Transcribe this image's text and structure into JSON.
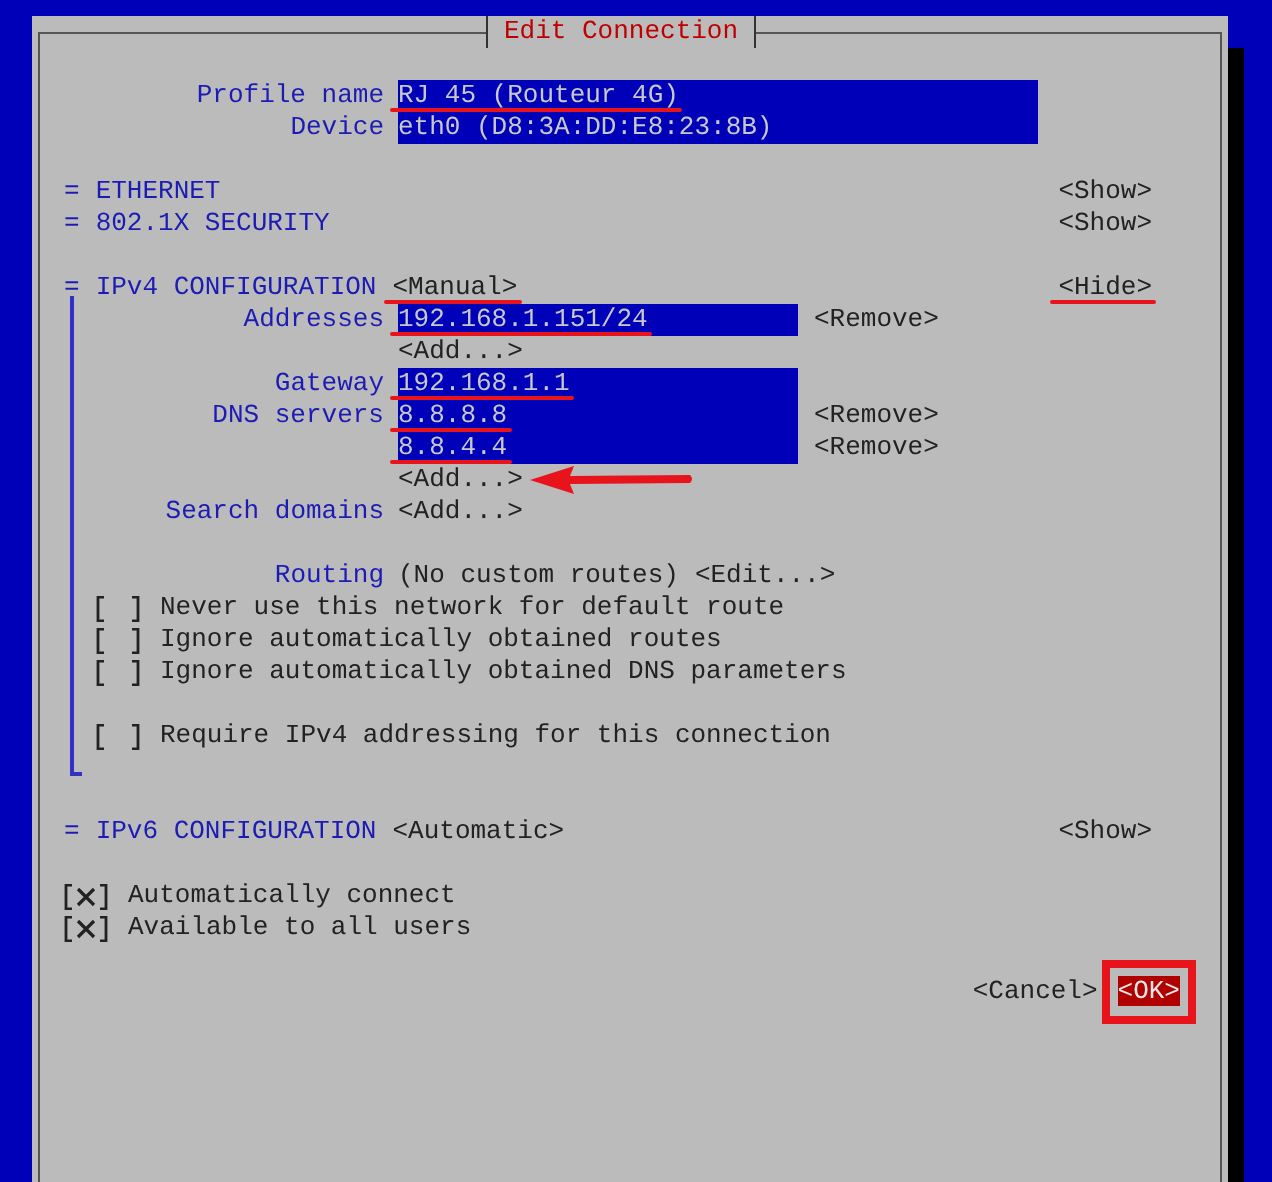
{
  "window": {
    "title": "Edit Connection"
  },
  "profile": {
    "label": "Profile name",
    "value": "RJ 45 (Routeur 4G)",
    "underlined": true
  },
  "device": {
    "label": "Device",
    "value": "eth0 (D8:3A:DD:E8:23:8B)"
  },
  "sections": [
    {
      "marker": "=",
      "title": "ETHERNET",
      "toggle": "<Show>"
    },
    {
      "marker": "=",
      "title": "802.1X SECURITY",
      "toggle": "<Show>"
    }
  ],
  "ipv4": {
    "marker": "=",
    "title": "IPv4 CONFIGURATION",
    "mode": "<Manual>",
    "mode_underlined": true,
    "toggle": "<Hide>",
    "toggle_underlined": true,
    "rows": [
      {
        "kind": "field",
        "label": "Addresses",
        "value": "192.168.1.151/24",
        "underlined": true,
        "action": "<Remove>"
      },
      {
        "kind": "button",
        "text": "<Add...>",
        "pointed": false
      },
      {
        "kind": "field",
        "label": "Gateway",
        "value": "192.168.1.1",
        "underlined": true
      },
      {
        "kind": "field",
        "label": "DNS servers",
        "value": "8.8.8.8",
        "underlined": true,
        "action": "<Remove>"
      },
      {
        "kind": "field",
        "value": "8.8.4.4",
        "underlined": true,
        "action": "<Remove>"
      },
      {
        "kind": "button",
        "text": "<Add...>",
        "pointed": true
      },
      {
        "kind": "button",
        "label": "Search domains",
        "text": "<Add...>",
        "pointed": false
      },
      {
        "kind": "routing",
        "label": "Routing",
        "value": "(No custom routes)",
        "action": "<Edit...>"
      }
    ],
    "option_groups": [
      [
        {
          "text": "Never use this network for default route",
          "checked": false
        },
        {
          "text": "Ignore automatically obtained routes",
          "checked": false
        },
        {
          "text": "Ignore automatically obtained DNS parameters",
          "checked": false
        }
      ],
      [
        {
          "text": "Require IPv4 addressing for this connection",
          "checked": false
        }
      ]
    ]
  },
  "ipv6": {
    "marker": "=",
    "title": "IPv6 CONFIGURATION",
    "mode": "<Automatic>",
    "toggle": "<Show>"
  },
  "general": [
    {
      "text": "Automatically connect",
      "checked": true
    },
    {
      "text": "Available to all users",
      "checked": true
    }
  ],
  "buttons": [
    {
      "label": "<Cancel>",
      "selected": false
    },
    {
      "label": "<OK>",
      "selected": true,
      "boxed": true
    }
  ]
}
